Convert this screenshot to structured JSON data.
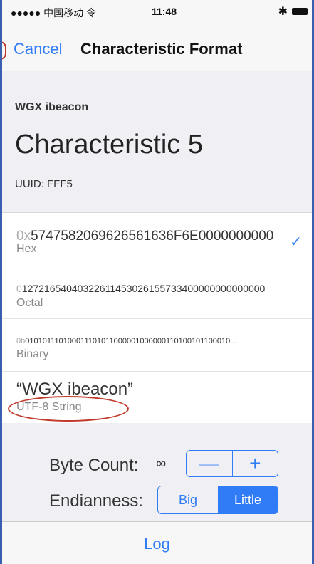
{
  "status": {
    "carrier": "●●●●● 中国移动 令",
    "time": "11:48",
    "bluetooth": "✱"
  },
  "nav": {
    "cancel": "Cancel",
    "title": "Characteristic Format"
  },
  "header": {
    "device": "WGX ibeacon",
    "characteristic": "Characteristic 5",
    "uuid": "UUID: FFF5"
  },
  "formats": [
    {
      "prefix": "0x",
      "value": "5747582069626561636F6E0000000000",
      "label": "Hex",
      "selected": true
    },
    {
      "prefix": "0",
      "value": "12721654040322611453026155733400000000000000",
      "label": "Octal"
    },
    {
      "prefix": "0b",
      "value": "010101110100011101011000001000000110100101100010...",
      "label": "Binary"
    },
    {
      "prefix": "",
      "value": "“WGX ibeacon”",
      "label": "UTF-8 String"
    }
  ],
  "byte_count": {
    "label": "Byte Count:",
    "value": "∞",
    "minus": "—",
    "plus": "+"
  },
  "endianness": {
    "label": "Endianness:",
    "options": [
      "Big",
      "Little"
    ],
    "selected": "Little"
  },
  "log": "Log",
  "colors": {
    "accent": "#2f7cf6",
    "annotation": "#c0392b"
  },
  "icons": {
    "check": "check-icon",
    "bluetooth": "bluetooth-icon",
    "battery": "battery-icon"
  }
}
